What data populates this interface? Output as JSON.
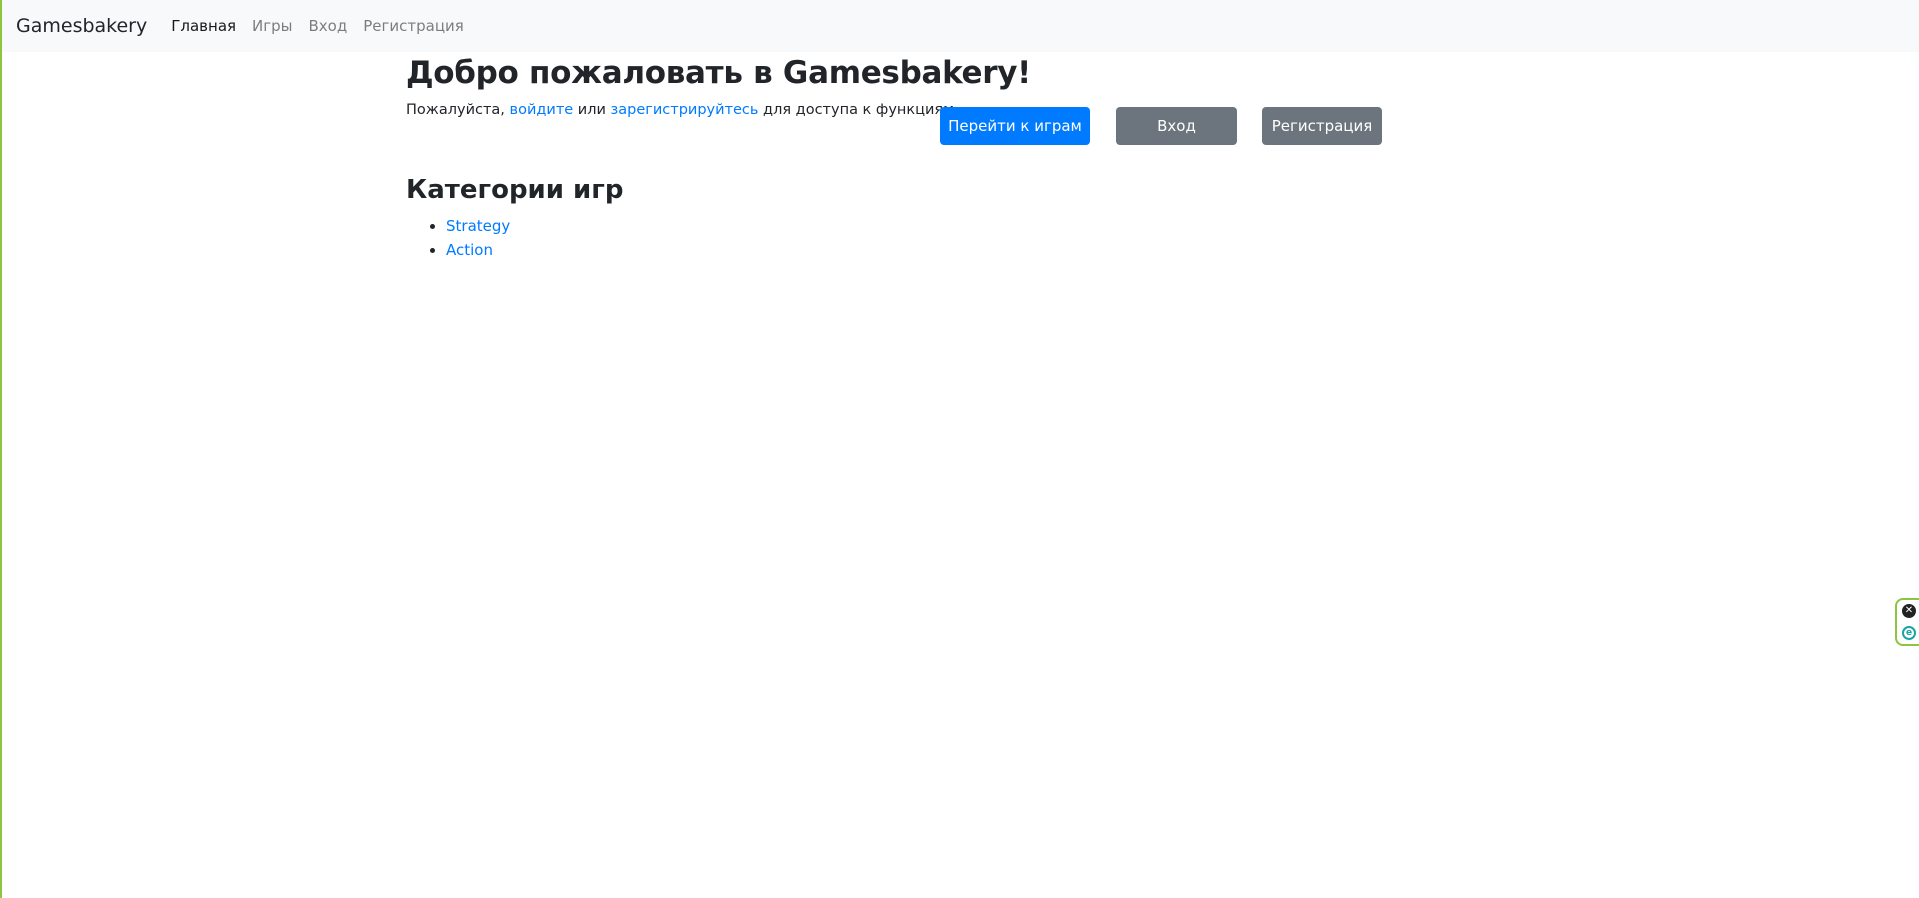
{
  "navbar": {
    "brand": "Gamesbakery",
    "links": [
      {
        "label": "Главная",
        "active": true
      },
      {
        "label": "Игры",
        "active": false
      },
      {
        "label": "Вход",
        "active": false
      },
      {
        "label": "Регистрация",
        "active": false
      }
    ]
  },
  "main": {
    "title": "Добро пожаловать в Gamesbakery!",
    "intro": {
      "prefix": "Пожалуйста, ",
      "login_link": "войдите",
      "middle": " или ",
      "register_link": "зарегистрируйтесь",
      "suffix": " для доступа к функциям."
    },
    "buttons": {
      "games": "Перейти к играм",
      "login": "Вход",
      "register": "Регистрация"
    },
    "categories_title": "Категории игр",
    "categories": [
      "Strategy",
      "Action"
    ]
  },
  "widget": {
    "close_glyph": "✕",
    "ext_glyph": "e"
  },
  "colors": {
    "primary": "#007bff",
    "secondary": "#6c757d",
    "navbar_bg": "#f8f9fa",
    "frame_border": "#8cc63f"
  }
}
